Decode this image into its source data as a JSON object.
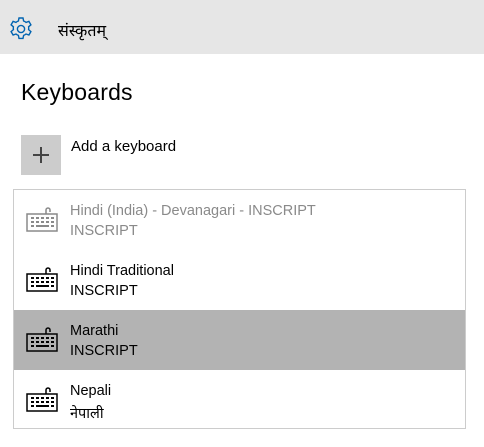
{
  "header": {
    "title": "संस्कृतम्",
    "icon": "gear-icon",
    "accent_color": "#0063b1",
    "background": "#e6e6e6"
  },
  "main": {
    "heading": "Keyboards",
    "add_keyboard": {
      "icon": "plus-icon",
      "label": "Add a keyboard"
    },
    "keyboards": [
      {
        "name": "Hindi (India) - Devanagari - INSCRIPT",
        "layout": "INSCRIPT",
        "state": "disabled"
      },
      {
        "name": "Hindi Traditional",
        "layout": "INSCRIPT",
        "state": "normal"
      },
      {
        "name": "Marathi",
        "layout": "INSCRIPT",
        "state": "selected"
      },
      {
        "name": "Nepali",
        "layout": "नेपाली",
        "state": "normal"
      }
    ],
    "selected_color": "#b3b3b3"
  }
}
